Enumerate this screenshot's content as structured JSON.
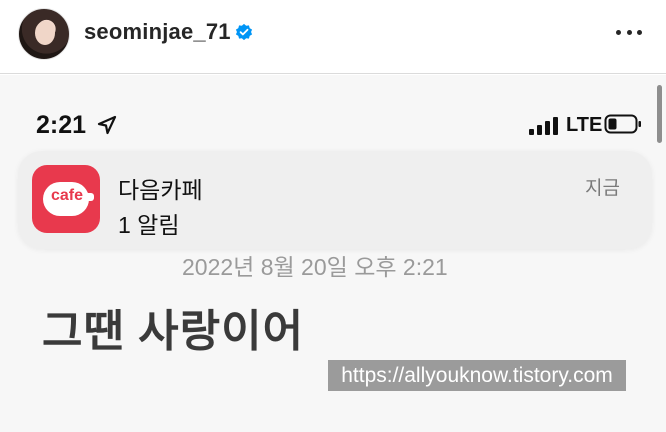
{
  "post_header": {
    "username": "seominjae_71"
  },
  "phone_status": {
    "time": "2:21",
    "network": "LTE"
  },
  "notification": {
    "app_icon_text": "cafe",
    "title": "다음카페",
    "body": "1 알림",
    "time": "지금"
  },
  "date_line": "2022년 8월 20일 오후 2:21",
  "message": "그땐 사랑이어",
  "watermark": "https://allyouknow.tistory.com",
  "colors": {
    "app_icon": "#e8394d",
    "verified_badge": "#0095f6"
  }
}
